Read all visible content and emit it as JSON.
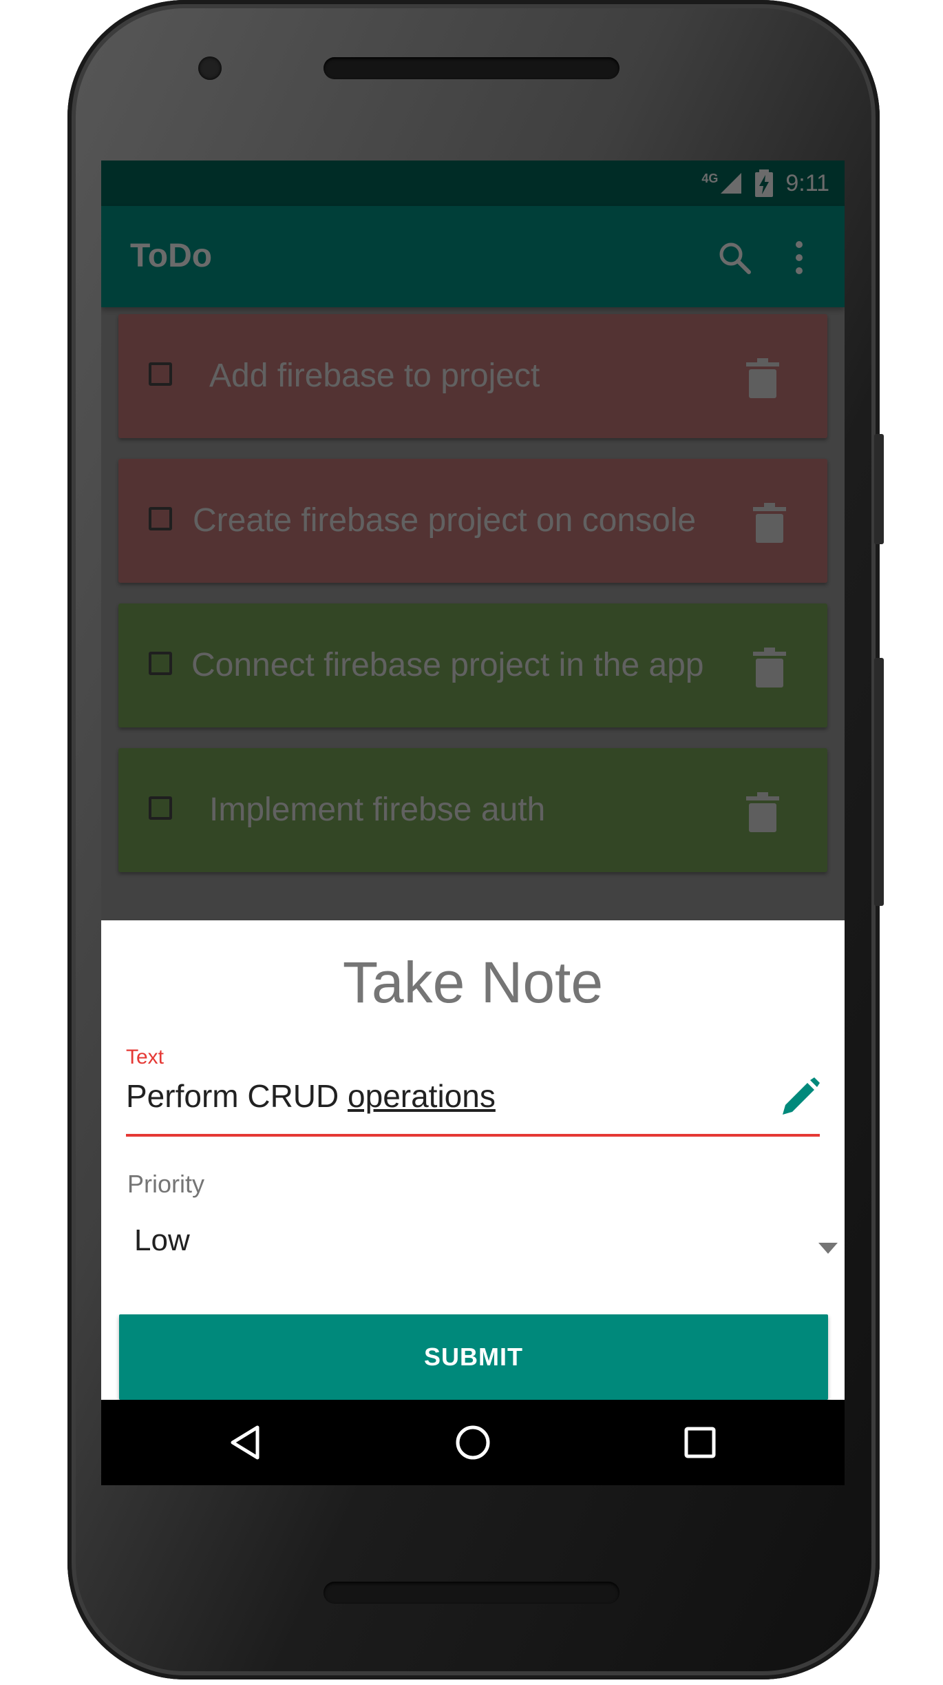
{
  "status_bar": {
    "network": "4G",
    "time": "9:11"
  },
  "app_bar": {
    "title": "ToDo",
    "search_icon": "search-icon",
    "overflow_icon": "more-vert-icon"
  },
  "todos": [
    {
      "text": "Add firebase to project",
      "color": "#c77b7b"
    },
    {
      "text": "Create firebase project on console",
      "color": "#c77b7b"
    },
    {
      "text": "Connect firebase project in the app",
      "color": "#7aa85a"
    },
    {
      "text": "Implement firebse auth",
      "color": "#7aa85a"
    }
  ],
  "dialog": {
    "title": "Take Note",
    "text_field": {
      "label": "Text",
      "value_plain": "Perform CRUD ",
      "value_underlined": "operations"
    },
    "priority": {
      "label": "Priority",
      "selected": "Low"
    },
    "submit_label": "SUBMIT"
  },
  "colors": {
    "primary": "#009688",
    "primary_dark": "#00695c",
    "accent_error": "#e53935",
    "button": "#00897b"
  }
}
